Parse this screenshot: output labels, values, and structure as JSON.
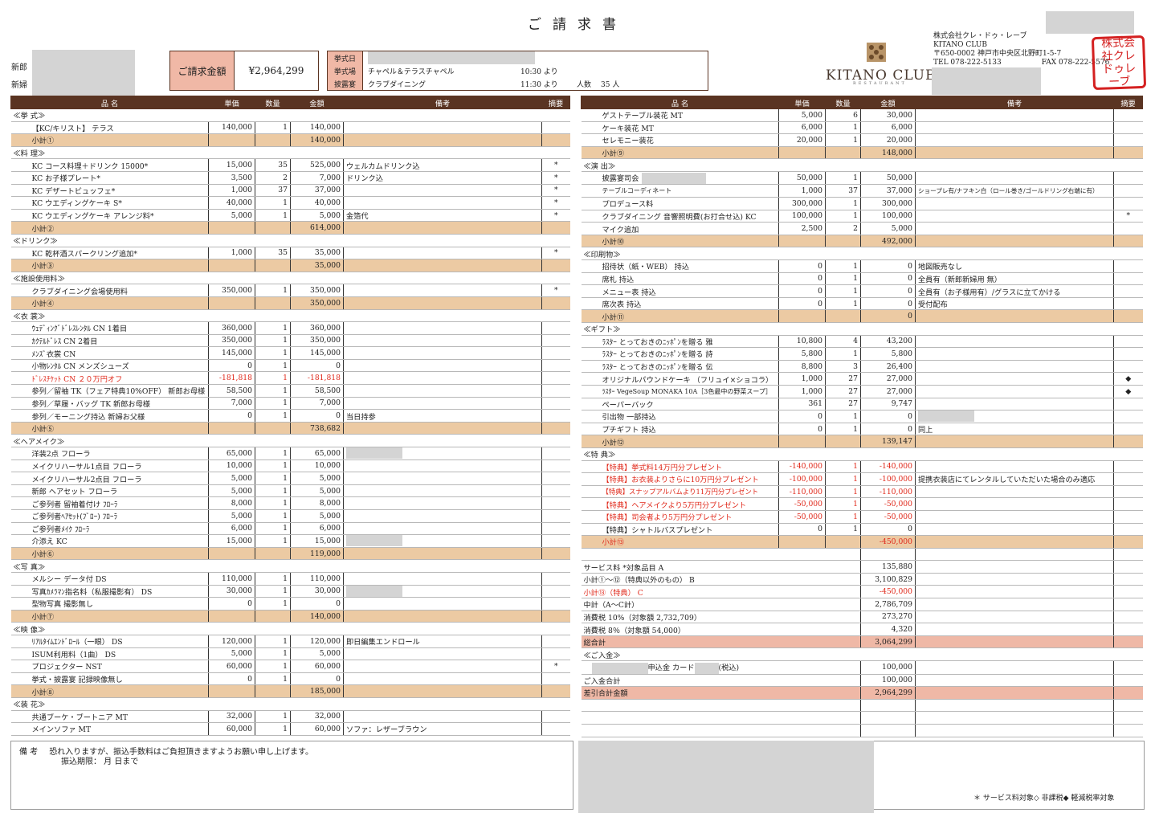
{
  "document": {
    "title": "ご請求書",
    "groom_label": "新郎",
    "bride_label": "新婦",
    "amount_label": "ご請求金額",
    "amount_value": "¥2,964,299"
  },
  "event": {
    "date_label": "挙式日",
    "ceremony_label": "挙式場",
    "ceremony_venue": "チャペル＆テラスチャペル",
    "ceremony_time": "10:30 より",
    "reception_label": "披露宴",
    "reception_venue": "クラブダイニング",
    "reception_time": "11:30 より",
    "guests_label": "人数",
    "guests_value": "35 人"
  },
  "company": {
    "logo_text": "KITANO CLUB",
    "logo_sub": "RESTAURANT",
    "name": "株式会社クレ・ドゥ・レーブ",
    "name_en": "KITANO CLUB",
    "address": "〒650-0002 神戸市中央区北野町1-5-7",
    "tel": "TEL 078-222-5133",
    "fax": "FAX 078-222-5576",
    "stamp_text": "株式会社クレドゥレーブ"
  },
  "columns": [
    "品 名",
    "単価",
    "数量",
    "金額",
    "備考",
    "摘要"
  ],
  "left_rows": [
    {
      "t": "sec",
      "name": "≪挙 式≫"
    },
    {
      "name": "【KC/キリスト】 テラス",
      "price": "140,000",
      "qty": "1",
      "amount": "140,000"
    },
    {
      "t": "sub",
      "name": "小計①",
      "amount": "140,000"
    },
    {
      "t": "sec",
      "name": "≪料 理≫"
    },
    {
      "name": "KC コース料理＋ドリンク 15000*",
      "price": "15,000",
      "qty": "35",
      "amount": "525,000",
      "note": "ウェルカムドリンク込",
      "mark": "*"
    },
    {
      "name": "KC お子様プレート*",
      "price": "3,500",
      "qty": "2",
      "amount": "7,000",
      "note": "ドリンク込",
      "mark": "*"
    },
    {
      "name": "KC デザートビュッフェ*",
      "price": "1,000",
      "qty": "37",
      "amount": "37,000",
      "mark": "*"
    },
    {
      "name": "KC ウエディングケーキ S*",
      "price": "40,000",
      "qty": "1",
      "amount": "40,000",
      "mark": "*"
    },
    {
      "name": "KC ウエディングケーキ アレンジ料*",
      "price": "5,000",
      "qty": "1",
      "amount": "5,000",
      "note": "金箔代",
      "mark": "*"
    },
    {
      "t": "sub",
      "name": "小計②",
      "amount": "614,000"
    },
    {
      "t": "sec",
      "name": "≪ドリンク≫"
    },
    {
      "name": "KC 乾杯酒スパークリング追加*",
      "price": "1,000",
      "qty": "35",
      "amount": "35,000",
      "mark": "*"
    },
    {
      "t": "sub",
      "name": "小計③",
      "amount": "35,000"
    },
    {
      "t": "sec",
      "name": "≪施設使用料≫"
    },
    {
      "name": "クラブダイニング会場使用料",
      "price": "350,000",
      "qty": "1",
      "amount": "350,000",
      "mark": "*"
    },
    {
      "t": "sub",
      "name": "小計④",
      "amount": "350,000"
    },
    {
      "t": "sec",
      "name": "≪衣 裳≫"
    },
    {
      "name": "ｳｪﾃﾞｨﾝｸﾞﾄﾞﾚｽﾚﾝﾀﾙ CN 1着目",
      "price": "360,000",
      "qty": "1",
      "amount": "360,000"
    },
    {
      "name": "ｶｸﾃﾙﾄﾞﾚｽ CN 2着目",
      "price": "350,000",
      "qty": "1",
      "amount": "350,000"
    },
    {
      "name": "ﾒﾝｽﾞ衣裳 CN",
      "price": "145,000",
      "qty": "1",
      "amount": "145,000"
    },
    {
      "name": "小物ﾚﾝﾀﾙ CN メンズシューズ",
      "price": "0",
      "qty": "1",
      "amount": "0"
    },
    {
      "red": true,
      "name": "ﾄﾞﾚｽﾁｹｯﾄ CN ２０万円オフ",
      "price": "-181,818",
      "qty": "1",
      "amount": "-181,818"
    },
    {
      "name": "参列／留袖 TK（フェア特典10%OFF） 新郎お母様",
      "price": "58,500",
      "qty": "1",
      "amount": "58,500"
    },
    {
      "name": "参列／草履・バッグ TK 新郎お母様",
      "price": "7,000",
      "qty": "1",
      "amount": "7,000"
    },
    {
      "name": "参列／モーニング持込 新婦お父様",
      "price": "0",
      "qty": "1",
      "amount": "0",
      "note": "当日持参"
    },
    {
      "t": "sub",
      "name": "小計⑤",
      "amount": "738,682"
    },
    {
      "t": "sec",
      "name": "≪ヘアメイク≫"
    },
    {
      "name": "洋装2点 フローラ",
      "price": "65,000",
      "qty": "1",
      "amount": "65,000",
      "redact": true
    },
    {
      "name": "メイクリハーサル1点目 フローラ",
      "price": "10,000",
      "qty": "1",
      "amount": "10,000"
    },
    {
      "name": "メイクリハーサル2点目 フローラ",
      "price": "5,000",
      "qty": "1",
      "amount": "5,000"
    },
    {
      "name": "新郎 ヘアセット フローラ",
      "price": "5,000",
      "qty": "1",
      "amount": "5,000"
    },
    {
      "name": "ご参列者 留袖着付け ﾌﾛｰﾗ",
      "price": "8,000",
      "qty": "1",
      "amount": "8,000"
    },
    {
      "name": "ご参列者ﾍｱｾｯﾄ(ﾌﾞﾛｰ) ﾌﾛｰﾗ",
      "price": "5,000",
      "qty": "1",
      "amount": "5,000"
    },
    {
      "name": "ご参列者ﾒｲｸ ﾌﾛｰﾗ",
      "price": "6,000",
      "qty": "1",
      "amount": "6,000"
    },
    {
      "name": "介添え KC",
      "price": "15,000",
      "qty": "1",
      "amount": "15,000",
      "redact": true
    },
    {
      "t": "sub",
      "name": "小計⑥",
      "amount": "119,000"
    },
    {
      "t": "sec",
      "name": "≪写 真≫"
    },
    {
      "name": "メルシー データ付 DS",
      "price": "110,000",
      "qty": "1",
      "amount": "110,000"
    },
    {
      "name": "写真ｶﾒﾗﾏﾝ指名料（私服撮影有） DS",
      "price": "30,000",
      "qty": "1",
      "amount": "30,000",
      "redact": true
    },
    {
      "name": "型物写真 撮影無し",
      "price": "0",
      "qty": "1",
      "amount": "0"
    },
    {
      "t": "sub",
      "name": "小計⑦",
      "amount": "140,000"
    },
    {
      "t": "sec",
      "name": "≪映 像≫"
    },
    {
      "name": "ﾘｱﾙﾀｲﾑｴﾝﾄﾞﾛｰﾙ（一眼） DS",
      "price": "120,000",
      "qty": "1",
      "amount": "120,000",
      "note": "即日編集エンドロール"
    },
    {
      "name": "ISUM利用料（1曲） DS",
      "price": "5,000",
      "qty": "1",
      "amount": "5,000"
    },
    {
      "name": "プロジェクター NST",
      "price": "60,000",
      "qty": "1",
      "amount": "60,000",
      "mark": "*"
    },
    {
      "name": "挙式・披露宴 記録映像無し",
      "price": "0",
      "qty": "1",
      "amount": "0"
    },
    {
      "t": "sub",
      "name": "小計⑧",
      "amount": "185,000"
    },
    {
      "t": "sec",
      "name": "≪装 花≫"
    },
    {
      "name": "共通ブーケ・ブートニア MT",
      "price": "32,000",
      "qty": "1",
      "amount": "32,000"
    },
    {
      "name": "メインソファ MT",
      "price": "60,000",
      "qty": "1",
      "amount": "60,000",
      "note": "ソファ：レザーブラウン"
    }
  ],
  "right_rows": [
    {
      "name": "ゲストテーブル装花 MT",
      "price": "5,000",
      "qty": "6",
      "amount": "30,000"
    },
    {
      "name": "ケーキ装花 MT",
      "price": "6,000",
      "qty": "1",
      "amount": "6,000"
    },
    {
      "name": "セレモニー装花",
      "price": "20,000",
      "qty": "1",
      "amount": "20,000"
    },
    {
      "t": "sub",
      "name": "小計⑨",
      "amount": "148,000"
    },
    {
      "t": "sec",
      "name": "≪演 出≫"
    },
    {
      "name": "披露宴司会",
      "price": "50,000",
      "qty": "1",
      "amount": "50,000",
      "redactName": true
    },
    {
      "name": "テーブルコーディネート",
      "price": "1,000",
      "qty": "37",
      "amount": "37,000",
      "note": "ショープレ有/ナフキン白（ロール巻き/ゴールドリング右端に有）",
      "tiny": true
    },
    {
      "name": "プロデュース料",
      "price": "300,000",
      "qty": "1",
      "amount": "300,000"
    },
    {
      "name": "クラブダイニング 音響照明費(お打合せ込) KC",
      "price": "100,000",
      "qty": "1",
      "amount": "100,000",
      "mark": "*"
    },
    {
      "name": "マイク追加",
      "price": "2,500",
      "qty": "2",
      "amount": "5,000"
    },
    {
      "t": "sub",
      "name": "小計⑩",
      "amount": "492,000"
    },
    {
      "t": "sec",
      "name": "≪印刷物≫"
    },
    {
      "name": "招待状（紙・WEB） 持込",
      "price": "0",
      "qty": "1",
      "amount": "0",
      "note": "地図販売なし"
    },
    {
      "name": "席札 持込",
      "price": "0",
      "qty": "1",
      "amount": "0",
      "note": "全員有（新郎新婦用 無）"
    },
    {
      "name": "メニュー表 持込",
      "price": "0",
      "qty": "1",
      "amount": "0",
      "note": "全員有（お子様用有）/グラスに立てかける"
    },
    {
      "name": "席次表 持込",
      "price": "0",
      "qty": "1",
      "amount": "0",
      "note": "受付配布"
    },
    {
      "t": "sub",
      "name": "小計⑪",
      "amount": "0"
    },
    {
      "t": "sec",
      "name": "≪ギフト≫"
    },
    {
      "name": "ﾗｽﾀｰ とっておきのﾆｯﾎﾟﾝを贈る 雅",
      "price": "10,800",
      "qty": "4",
      "amount": "43,200"
    },
    {
      "name": "ﾗｽﾀｰ とっておきのﾆｯﾎﾟﾝを贈る 詩",
      "price": "5,800",
      "qty": "1",
      "amount": "5,800"
    },
    {
      "name": "ﾗｽﾀｰ とっておきのﾆｯﾎﾟﾝを贈る 伝",
      "price": "8,800",
      "qty": "3",
      "amount": "26,400"
    },
    {
      "name": "オリジナルパウンドケーキ （フリュイ×ショコラ）",
      "price": "1,000",
      "qty": "27",
      "amount": "27,000",
      "mark": "◆"
    },
    {
      "name": "ﾗｽﾀｰ VegeSoup MONAKA 10A［3色最中の野菜スープ］",
      "price": "1,000",
      "qty": "27",
      "amount": "27,000",
      "mark": "◆",
      "tiny": true
    },
    {
      "name": "ペーパーバック",
      "price": "361",
      "qty": "27",
      "amount": "9,747"
    },
    {
      "name": "引出物 一部持込",
      "price": "0",
      "qty": "1",
      "amount": "0",
      "redact": true
    },
    {
      "name": "プチギフト 持込",
      "price": "0",
      "qty": "1",
      "amount": "0",
      "note": "同上"
    },
    {
      "t": "sub",
      "name": "小計⑫",
      "amount": "139,147"
    },
    {
      "t": "sec",
      "name": "≪特 典≫"
    },
    {
      "red": true,
      "name": "【特典】挙式料14万円分プレゼント",
      "price": "-140,000",
      "qty": "1",
      "amount": "-140,000"
    },
    {
      "red": true,
      "name": "【特典】お衣装よりさらに10万円分プレゼント",
      "price": "-100,000",
      "qty": "1",
      "amount": "-100,000",
      "note": "提携衣装店にてレンタルしていただいた場合のみ適応"
    },
    {
      "red": true,
      "name": "【特典】スナップアルバムより11万円分プレゼント",
      "price": "-110,000",
      "qty": "1",
      "amount": "-110,000",
      "tinyName": true
    },
    {
      "red": true,
      "name": "【特典】ヘアメイクより5万円分プレゼント",
      "price": "-50,000",
      "qty": "1",
      "amount": "-50,000"
    },
    {
      "red": true,
      "name": "【特典】司会者より5万円分プレゼント",
      "price": "-50,000",
      "qty": "1",
      "amount": "-50,000"
    },
    {
      "name": "【特典】シャトルバスプレゼント",
      "price": "0",
      "qty": "1",
      "amount": "0"
    },
    {
      "t": "sub",
      "red": true,
      "name": "小計⑬",
      "amount": "-450,000"
    },
    {
      "t": "blank"
    },
    {
      "t": "sum",
      "name": "サービス料 *対象品目 A",
      "amount": "135,880"
    },
    {
      "t": "sum",
      "name": "小計①～⑫（特典以外のもの） B",
      "amount": "3,100,829"
    },
    {
      "t": "sum",
      "red": true,
      "name": "小計⑬（特典） C",
      "amount": "-450,000"
    },
    {
      "t": "sum",
      "name": "中計（A～C計）",
      "amount": "2,786,709"
    },
    {
      "t": "sum",
      "name": "消費税 10%（対象額 2,732,709）",
      "amount": "273,270"
    },
    {
      "t": "sum",
      "name": "消費税 8％（対象額 54,000）",
      "amount": "4,320"
    },
    {
      "t": "total",
      "name": "総合計",
      "amount": "3,064,299"
    },
    {
      "t": "sec",
      "name": "≪ご入金≫"
    },
    {
      "t": "pay",
      "name1": "申込金 カード",
      "name2": "(税込)",
      "amount": "100,000"
    },
    {
      "t": "sum",
      "name": "ご入金合計",
      "amount": "100,000"
    },
    {
      "t": "total",
      "name": "差引合計金額",
      "amount": "2,964,299"
    },
    {
      "t": "blank"
    },
    {
      "t": "blank"
    },
    {
      "t": "blank"
    }
  ],
  "footer": {
    "remarks_label": "備 考",
    "remarks_line1": "恐れ入りますが、振込手数料はご負担頂きますようお願い申し上げます。",
    "remarks_line2": "振込期限： 月 日まで",
    "legend": "＊ サービス料対象◇ 非課税◆ 軽減税率対象"
  },
  "colors": {
    "header": "#5a3422",
    "subtotal": "#eccaa3",
    "total": "#efb8a6",
    "red": "#e0281a"
  }
}
